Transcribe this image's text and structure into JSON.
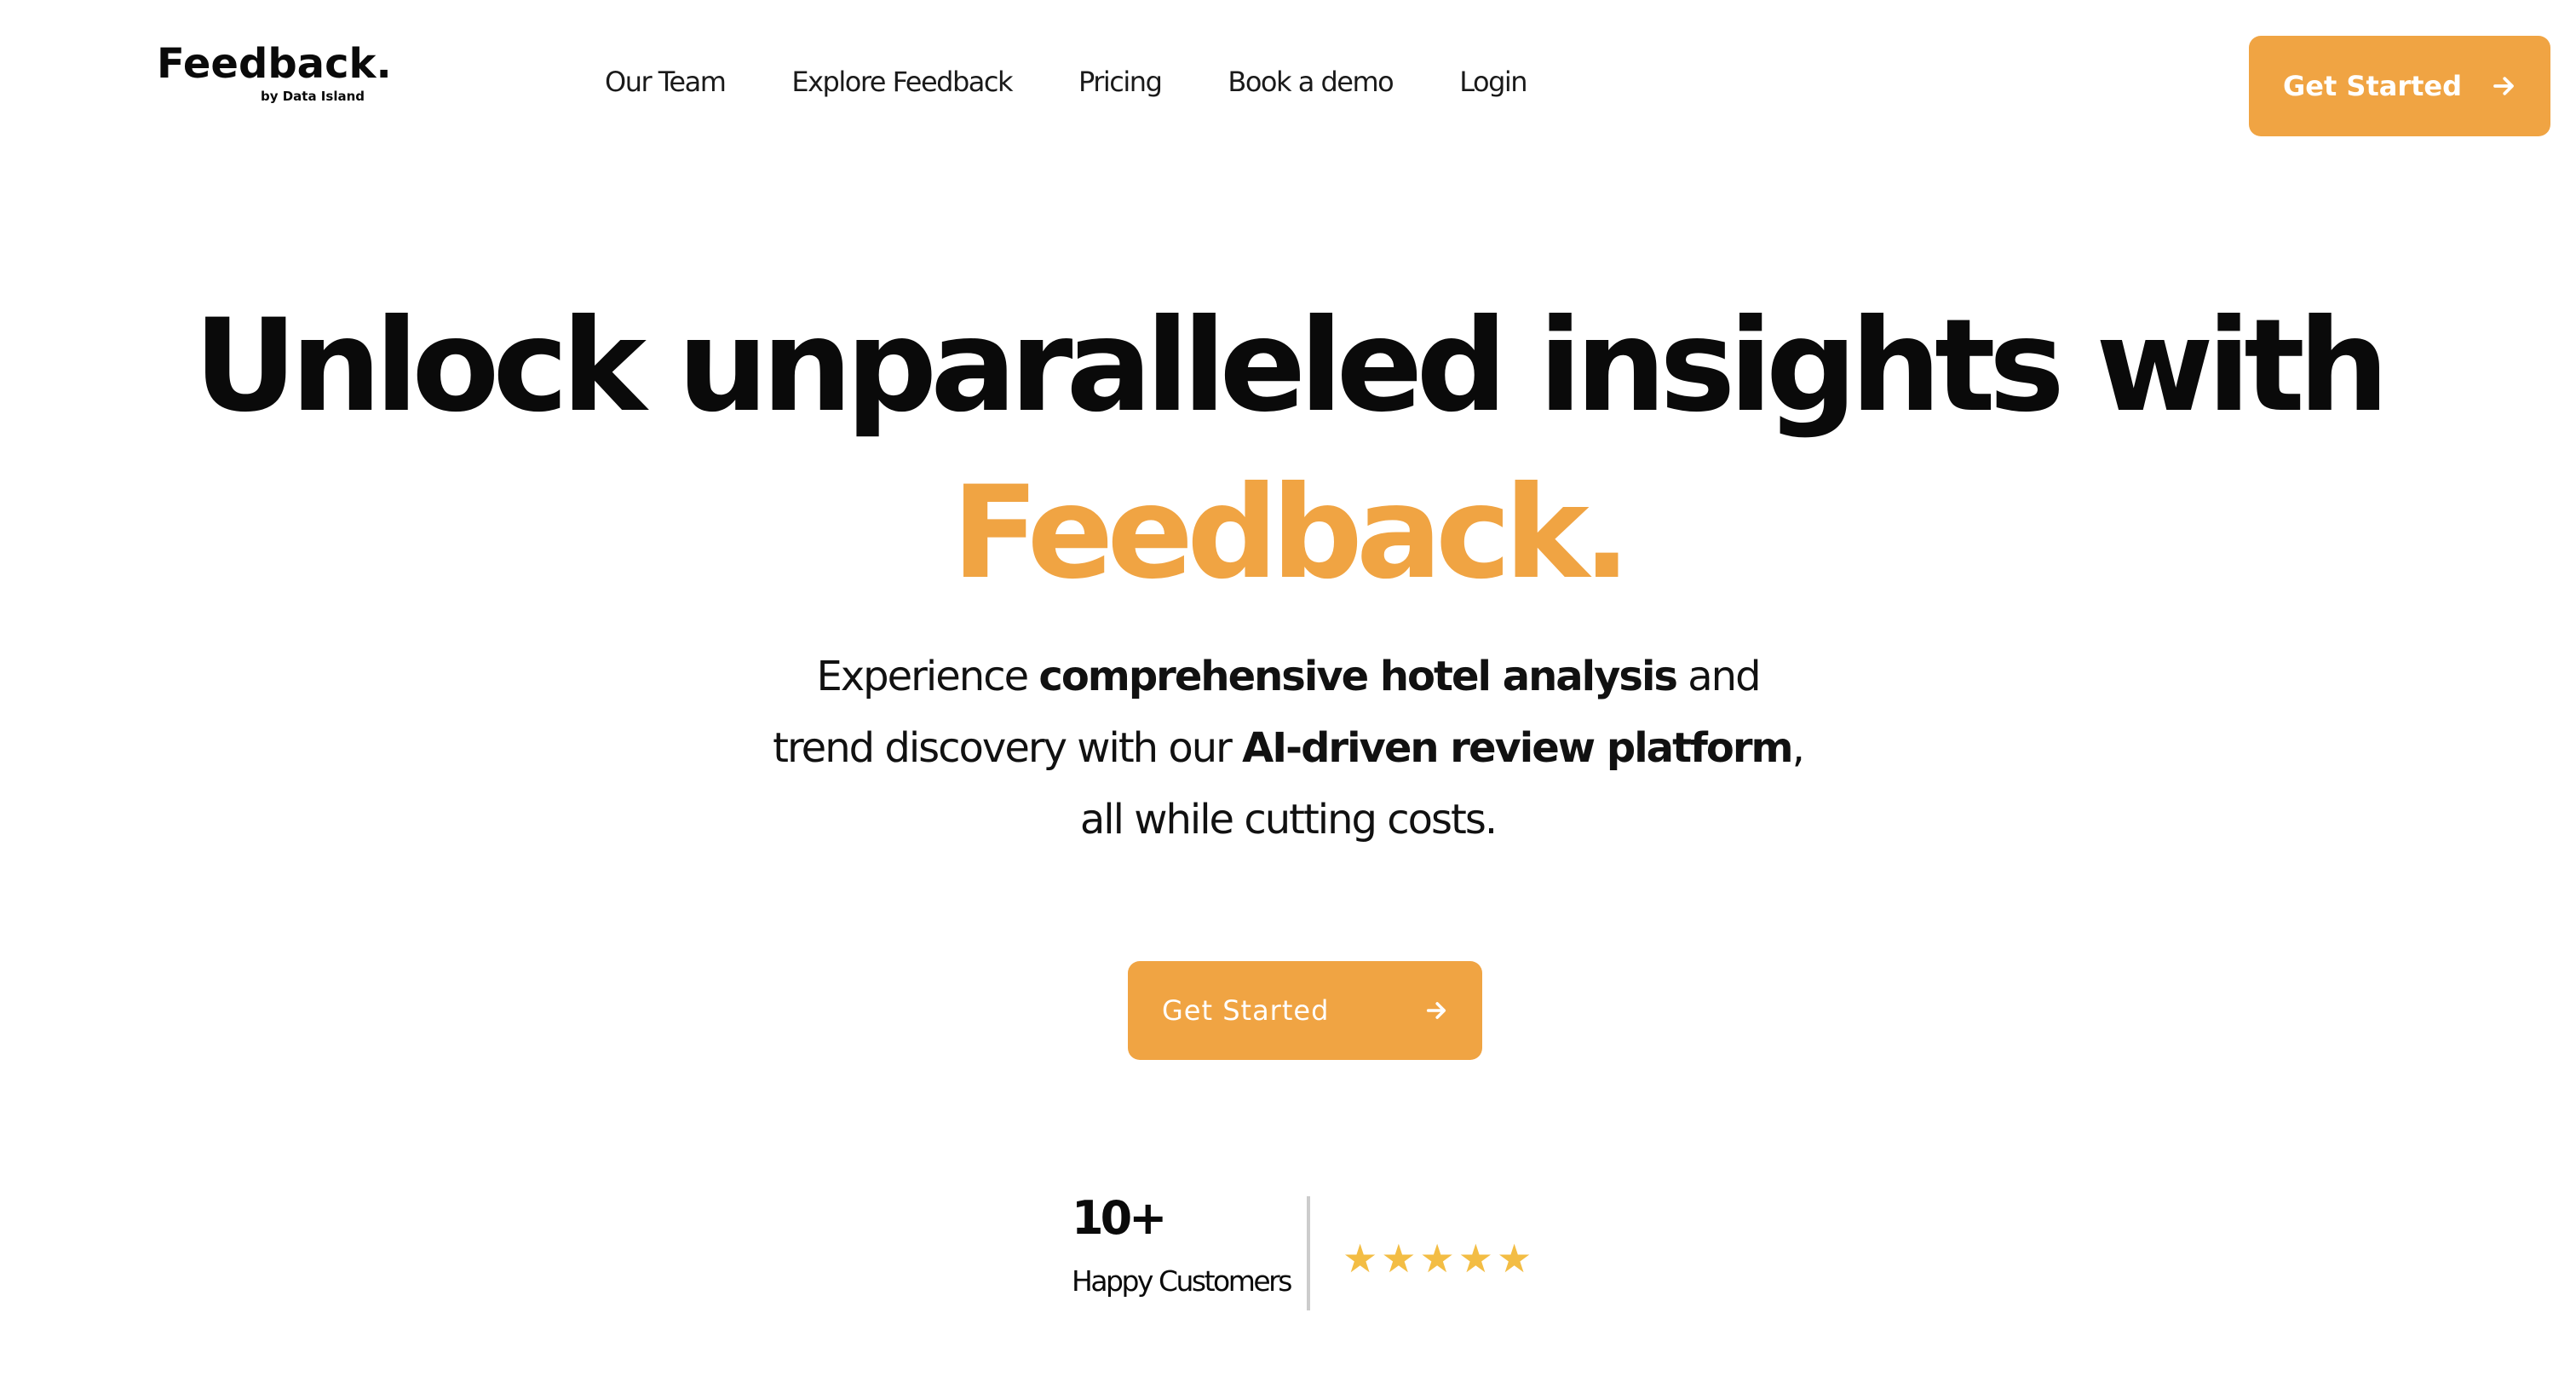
{
  "header": {
    "logo": {
      "name": "Feedback.",
      "tagline": "by Data Island"
    },
    "nav": [
      {
        "label": "Our Team"
      },
      {
        "label": "Explore Feedback"
      },
      {
        "label": "Pricing"
      },
      {
        "label": "Book a demo"
      },
      {
        "label": "Login"
      }
    ],
    "cta": {
      "label": "Get Started",
      "icon": "arrow-right-icon"
    }
  },
  "hero": {
    "title_line1": "Unlock unparalleled insights with",
    "title_brand": "Feedback.",
    "subtitle": {
      "part1": "Experience ",
      "bold1": "comprehensive hotel analysis",
      "part2": " and trend discovery with our ",
      "bold2": "AI-driven review platform",
      "part3": ", all while cutting costs."
    },
    "cta": {
      "label": "Get Started",
      "icon": "arrow-right-icon"
    }
  },
  "stats": {
    "count": "10+",
    "label": "Happy Customers",
    "rating": {
      "value": 5,
      "max": 5,
      "glyph": "★"
    }
  },
  "colors": {
    "accent": "#f0a443",
    "star": "#f3bd44",
    "text": "#0a0a0a",
    "divider": "#cccccc"
  }
}
